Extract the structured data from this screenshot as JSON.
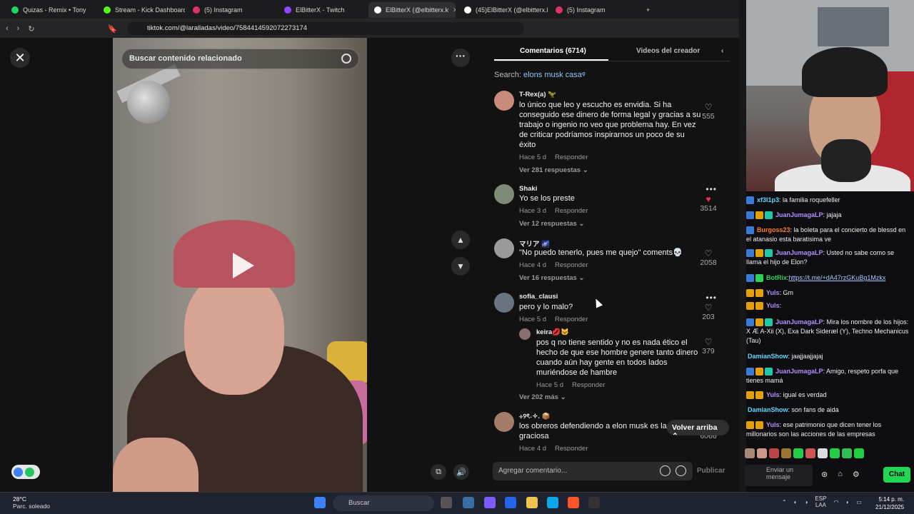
{
  "browser": {
    "tabs": [
      {
        "title": "Quizas - Remix • Tony",
        "color": "#1ed760"
      },
      {
        "title": "Stream - Kick Dashboard",
        "color": "#53fc18"
      },
      {
        "title": "(5) Instagram",
        "color": "#e1306c"
      },
      {
        "title": "ElBitterX - Twitch",
        "color": "#9146ff"
      },
      {
        "title": "ElBitterX (@elbitterx.k",
        "color": "#ffffff",
        "active": true
      },
      {
        "title": "(45)ElBitterX (@elbitterx.k",
        "color": "#ffffff"
      },
      {
        "title": "(5) Instagram",
        "color": "#e1306c"
      }
    ],
    "new_tab": "+",
    "url": "tiktok.com/@laralladas/video/7584414592072273174"
  },
  "video": {
    "search_placeholder": "Buscar contenido relacionado"
  },
  "comments_panel": {
    "tab_comments": "Comentarios (6714)",
    "tab_creator": "Videos del creador",
    "search_label": "Search:",
    "search_term": "elons musk casa",
    "comments": [
      {
        "user": "T-Rex(a) 🦖",
        "text": "lo único que leo y escucho es envidia. Si ha conseguido ese dinero de forma legal y gracias a su trabajo o ingenio no veo que problema hay. En vez de criticar podríamos inspirarnos un poco de su éxito",
        "time": "Hace 5 d",
        "reply": "Responder",
        "likes": "555",
        "replies": "Ver 281 respuestas",
        "liked": false,
        "avatar": "#c98b7a"
      },
      {
        "user": "Shaki",
        "text": "Yo se los preste",
        "time": "Hace 3 d",
        "reply": "Responder",
        "likes": "3514",
        "replies": "Ver 12 respuestas",
        "liked": true,
        "avatar": "#7f8a78"
      },
      {
        "user": "マリア 🌌",
        "text": "\"No puedo tenerlo, pues me quejo\" coments💀",
        "time": "Hace 4 d",
        "reply": "Responder",
        "likes": "2058",
        "replies": "Ver 16 respuestas",
        "liked": false,
        "avatar": "#9a9a9a"
      },
      {
        "user": "sofia_clausi",
        "text": "pero y lo malo?",
        "time": "Hace 5 d",
        "reply": "Responder",
        "likes": "203",
        "replies": "Ver 202 más",
        "liked": false,
        "avatar": "#6b7280"
      },
      {
        "user": "⊹୨ৎ˖✧. 📦",
        "text": "los obreros defendiendo a elon musk es la más graciosa",
        "time": "Hace 4 d",
        "reply": "Responder",
        "likes": "6066",
        "liked": false,
        "avatar": "#a57b6a"
      }
    ],
    "reply": {
      "user": "keira💋🐱",
      "text": "pos q no tiene sentido y no es nada ético el hecho de que ese hombre genere tanto dinero cuando aún hay gente en todos lados muriéndose de hambre",
      "time": "Hace 5 d",
      "reply": "Responder",
      "likes": "379"
    },
    "back_to_top": "Volver arriba",
    "add_comment_placeholder": "Agregar comentario...",
    "publish": "Publicar"
  },
  "twitch_chat": {
    "messages": [
      {
        "user": "xf3l1p3",
        "color": "#5fd7ff",
        "text": " la familia roquefeller",
        "badges": [
          "#3a7bd5"
        ]
      },
      {
        "user": "JuanJumagaLP",
        "color": "#b48cff",
        "text": " jajaja",
        "badges": [
          "#3a7bd5",
          "#e3a008",
          "#1ec9a8"
        ]
      },
      {
        "user": "Burgoss23",
        "color": "#ff7a2f",
        "text": " la boleta para el concierto de blessd en el atanasio esta baratisima ve",
        "badges": [
          "#3a7bd5"
        ]
      },
      {
        "user": "JuanJumagaLP",
        "color": "#b48cff",
        "text": " Usted no sabe como se llama el hijo de Elon?",
        "badges": [
          "#3a7bd5",
          "#e3a008",
          "#1ec9a8"
        ]
      },
      {
        "user": "BotRix",
        "color": "#2fd05a",
        "text": "",
        "link": "https://t.me/+dA47rzGKuBg1Mzkx",
        "badges": [
          "#3a7bd5",
          "#2fd05a"
        ]
      },
      {
        "user": "Yuls",
        "color": "#b48cff",
        "text": " Gm",
        "badges": [
          "#e3a008",
          "#e3a008"
        ]
      },
      {
        "user": "Yuls",
        "color": "#b48cff",
        "text": " ",
        "badges": [
          "#e3a008",
          "#e3a008"
        ]
      },
      {
        "user": "JuanJumagaLP",
        "color": "#b48cff",
        "text": " Mira los nombre de los hijos: X Æ A-Xii (X), Exa Dark Sideræl (Y), Techno Mechanicus (Tau)",
        "badges": [
          "#3a7bd5",
          "#e3a008",
          "#1ec9a8"
        ]
      },
      {
        "user": "DamianShow",
        "color": "#5fd7ff",
        "text": " jaajjaajjajaj",
        "badges": []
      },
      {
        "user": "JuanJumagaLP",
        "color": "#b48cff",
        "text": " Amigo, respeto porfa que tienes mamá",
        "badges": [
          "#3a7bd5",
          "#e3a008",
          "#1ec9a8"
        ]
      },
      {
        "user": "Yuls",
        "color": "#b48cff",
        "text": " igual es verdad",
        "badges": [
          "#e3a008",
          "#e3a008"
        ]
      },
      {
        "user": "DamianShow",
        "color": "#5fd7ff",
        "text": " son fans de aida",
        "badges": []
      },
      {
        "user": "Yuls",
        "color": "#b48cff",
        "text": " ese patrimonio que dicen tener los millonarios son las acciones de las empresas",
        "badges": [
          "#e3a008",
          "#e3a008"
        ]
      }
    ],
    "input_placeholder": "Enviar un mensaje",
    "chat_button": "Chat"
  },
  "taskbar": {
    "temperature": "28°C",
    "weather": "Parc. soleado",
    "search": "Buscar",
    "lang": "ESP",
    "lang2": "LAA",
    "time": "5:14 p. m.",
    "date": "21/12/2025"
  }
}
